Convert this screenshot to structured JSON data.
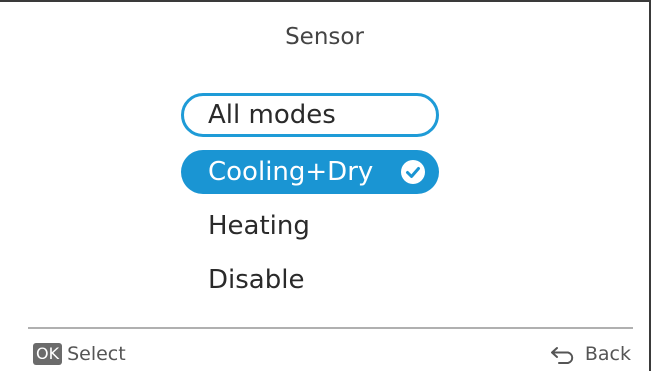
{
  "header": {
    "title": "Sensor"
  },
  "options": [
    {
      "label": "All modes"
    },
    {
      "label": "Cooling+Dry"
    },
    {
      "label": "Heating"
    },
    {
      "label": "Disable"
    }
  ],
  "footer": {
    "ok_key": "OK",
    "select_label": "Select",
    "back_label": "Back"
  },
  "colors": {
    "accent": "#1a95d3",
    "outline": "#1e9bd7"
  },
  "icons": {
    "selected_mark": "check-circle-icon",
    "back": "return-arrow-icon"
  }
}
